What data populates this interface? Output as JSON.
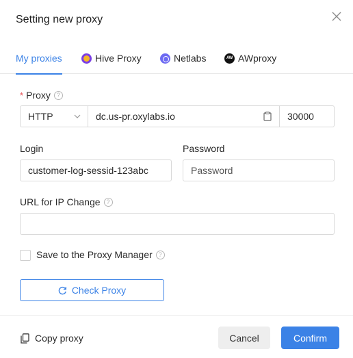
{
  "dialog": {
    "title": "Setting new proxy"
  },
  "tabs": [
    {
      "label": "My proxies",
      "active": true
    },
    {
      "label": "Hive Proxy",
      "icon": "hive-proxy-icon"
    },
    {
      "label": "Netlabs",
      "icon": "netlabs-icon"
    },
    {
      "label": "AWproxy",
      "icon": "awproxy-icon",
      "icon_text": "AW"
    }
  ],
  "proxy": {
    "label": "Proxy",
    "required_mark": "*",
    "protocol": "HTTP",
    "host": "dc.us-pr.oxylabs.io",
    "port": "30000"
  },
  "login": {
    "label": "Login",
    "value": "customer-log-sessid-123abc"
  },
  "password": {
    "label": "Password",
    "placeholder": "Password"
  },
  "url_change": {
    "label": "URL for IP Change",
    "value": ""
  },
  "save_to_manager": {
    "label": "Save to the Proxy Manager",
    "checked": false
  },
  "check_proxy": {
    "label": "Check Proxy"
  },
  "footer": {
    "copy_label": "Copy proxy",
    "cancel_label": "Cancel",
    "confirm_label": "Confirm"
  },
  "colors": {
    "accent": "#3b82e6",
    "required": "#e5484d"
  }
}
